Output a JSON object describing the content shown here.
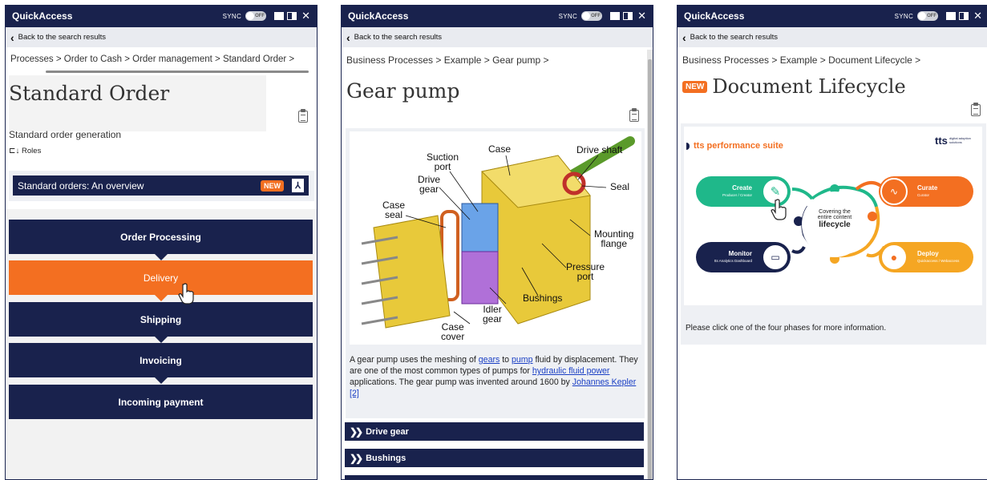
{
  "app": {
    "title": "QuickAccess",
    "sync_label": "SYNC",
    "toggle_state": "OFF",
    "back_label": "Back to the search results"
  },
  "colors": {
    "navy": "#19224d",
    "orange": "#f36f21",
    "link": "#1a3fc4",
    "green": "#1fb88a"
  },
  "panel1": {
    "breadcrumb": "Processes > Order to Cash > Order management > Standard Order >",
    "title": "Standard Order",
    "description": "Standard order generation",
    "roles_label": "Roles",
    "overview_bar": {
      "label": "Standard orders: An overview",
      "badge": "NEW"
    },
    "flow": [
      {
        "label": "Order Processing",
        "active": false
      },
      {
        "label": "Delivery",
        "active": true
      },
      {
        "label": "Shipping",
        "active": false
      },
      {
        "label": "Invoicing",
        "active": false
      },
      {
        "label": "Incoming payment",
        "active": false
      }
    ]
  },
  "panel2": {
    "breadcrumb": "Business Processes > Example > Gear pump >",
    "title": "Gear pump",
    "diagram_labels": {
      "case": "Case",
      "drive_shaft": "Drive shaft",
      "suction_port": "Suction\nport",
      "drive_gear": "Drive\ngear",
      "seal": "Seal",
      "case_seal": "Case\nseal",
      "mounting_flange": "Mounting\nflange",
      "pressure_port": "Pressure\nport",
      "bushings": "Bushings",
      "idler_gear": "Idler\ngear",
      "case_cover": "Case\ncover"
    },
    "desc_parts": {
      "p1": "A gear pump uses the meshing of ",
      "link_gears": "gears",
      "p2": " to ",
      "link_pump": "pump",
      "p3": " fluid by displacement. They are one of the most common types of pumps for ",
      "link_hydraulic": "hydraulic fluid power",
      "p4": " applications. The gear pump was invented around 1600 by ",
      "link_kepler": "Johannes Kepler",
      "link_ref": "[2]"
    },
    "accordion": [
      "Drive gear",
      "Bushings"
    ]
  },
  "panel3": {
    "breadcrumb": "Business Processes > Example > Document Lifecycle >",
    "badge": "NEW",
    "title": "Document Lifecycle",
    "suite_title": "tts performance suite",
    "logo": "tts",
    "logo_sub": "digital adoption solutions",
    "center": {
      "line1": "Covering the",
      "line2": "entire content",
      "line3": "lifecycle"
    },
    "phases": {
      "create": {
        "title": "Create",
        "sub": "Producer / Creator"
      },
      "curate": {
        "title": "Curate",
        "sub": "Curator"
      },
      "monitor": {
        "title": "Monitor",
        "sub": "tts Analytics Dashboard"
      },
      "deploy": {
        "title": "Deploy",
        "sub": "Quickaccess / Webaccess"
      }
    },
    "instruction": "Please click one of the four phases for more information."
  }
}
